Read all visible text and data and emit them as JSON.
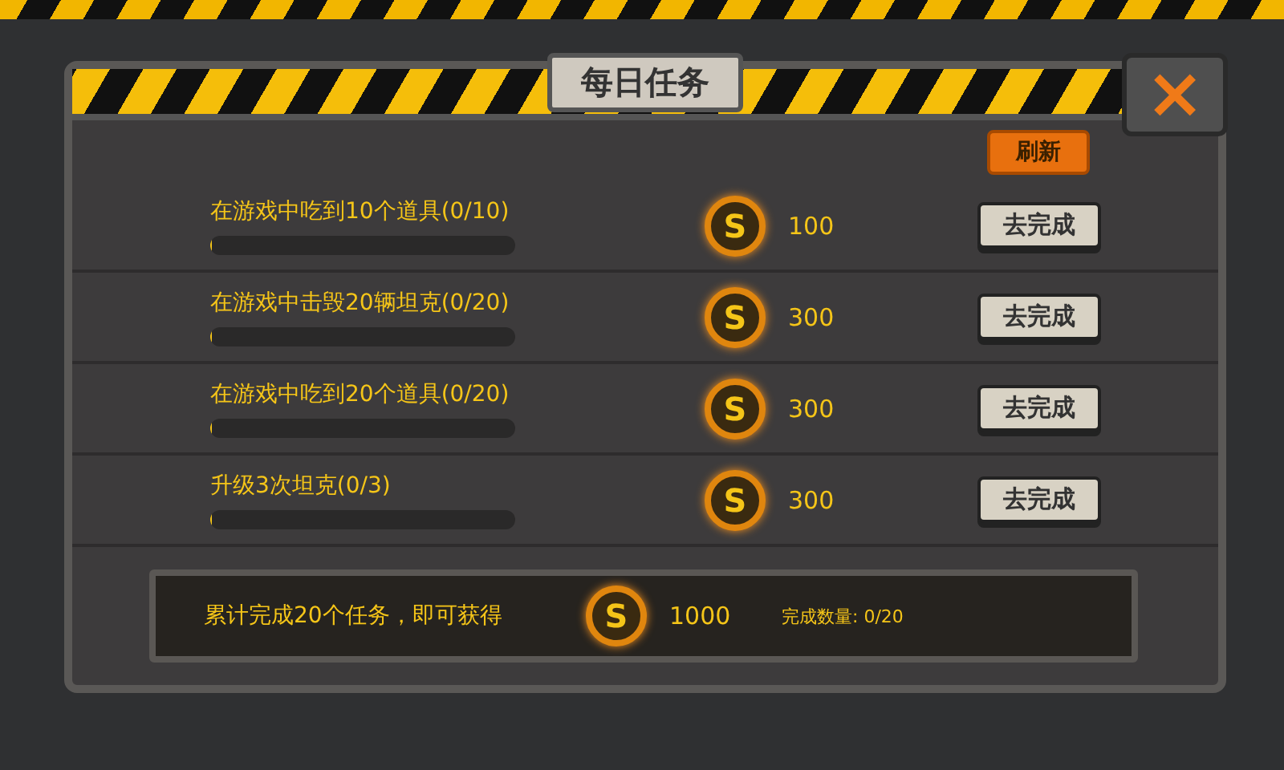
{
  "title": "每日任务",
  "close": {
    "label": "×"
  },
  "refresh_button": "刷新",
  "tasks": [
    {
      "text": "在游戏中吃到10个道具(0/10)",
      "level": 0,
      "coin": "S",
      "reward": "100",
      "action": "去完成"
    },
    {
      "text": "在游戏中击毁20辆坦克(0/20)",
      "level": 0,
      "coin": "S",
      "reward": "300",
      "action": "去完成"
    },
    {
      "text": "在游戏中吃到20个道具(0/20)",
      "level": 0,
      "coin": "S",
      "reward": "300",
      "action": "去完成"
    },
    {
      "text": "升级3次坦克(0/3)",
      "level": 0,
      "coin": "S",
      "reward": "300",
      "action": "去完成"
    }
  ],
  "summary": {
    "text": "累计完成20个任务，即可获得",
    "coin": "S",
    "reward": "1000",
    "count": "完成数量: 0/20"
  }
}
